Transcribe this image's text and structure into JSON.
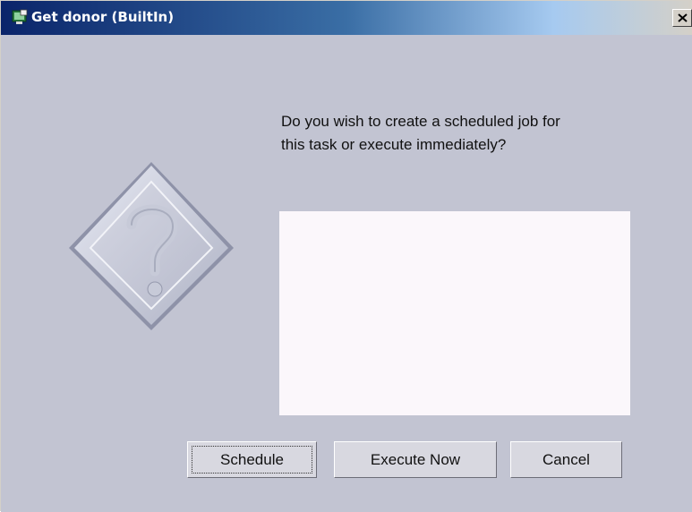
{
  "window": {
    "title": "Get donor (BuiltIn)",
    "icons": {
      "app": "java-app-icon",
      "close": "close-icon"
    }
  },
  "dialog": {
    "icon": "question-icon",
    "message_line1": "Do you wish to create a scheduled job for",
    "message_line2": "this task or execute immediately?",
    "details_text": ""
  },
  "buttons": {
    "schedule": "Schedule",
    "execute_now": "Execute Now",
    "cancel": "Cancel"
  },
  "colors": {
    "dialog_background": "#c2c4d2",
    "titlebar_active": "#0a246a",
    "textbox_background": "#fbf7fb"
  }
}
